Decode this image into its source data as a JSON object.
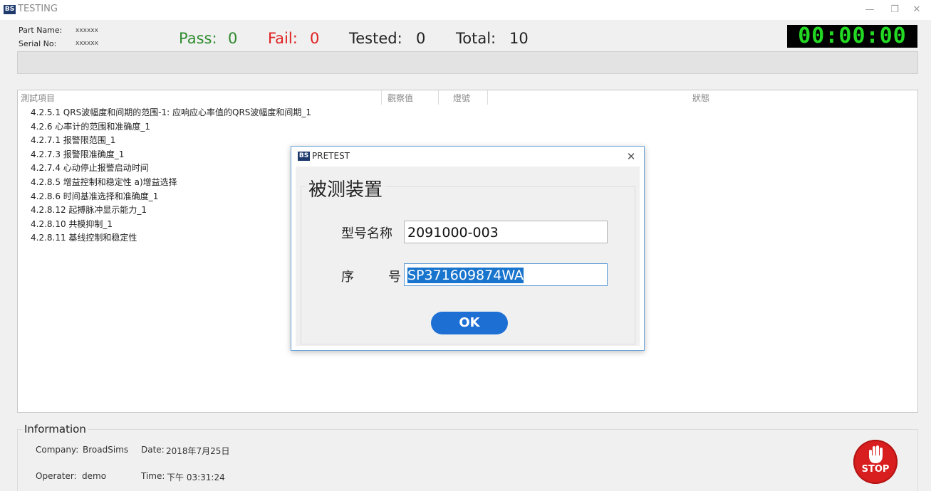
{
  "window": {
    "logo": "BS",
    "title": "TESTING",
    "controls": {
      "minimize": "—",
      "maximize": "❐",
      "close": "✕"
    }
  },
  "header": {
    "part_name_label": "Part Name:",
    "part_name_value": "xxxxxx",
    "serial_no_label": "Serial No:",
    "serial_no_value": "xxxxxx",
    "pass_label": "Pass:",
    "pass_value": "0",
    "fail_label": "Fail:",
    "fail_value": "0",
    "tested_label": "Tested:",
    "tested_value": "0",
    "total_label": "Total:",
    "total_value": "10",
    "timer": "00:00:00",
    "colors": {
      "pass": "#2e8b2e",
      "fail": "#e02020",
      "timer": "#23d923"
    }
  },
  "list": {
    "columns": [
      "測試項目",
      "觀察值",
      "燈號",
      "狀態"
    ],
    "items": [
      "4.2.5.1 QRS波幅度和间期的范围-1: 应响应心率值的QRS波幅度和间期_1",
      "4.2.6 心率计的范围和准确度_1",
      "4.2.7.1 报警限范围_1",
      "4.2.7.3 报警限准确度_1",
      "4.2.7.4 心动停止报警启动时间",
      "4.2.8.5 增益控制和稳定性 a)增益选择",
      "4.2.8.6 时间基准选择和准确度_1",
      "4.2.8.12 起搏脉冲显示能力_1",
      "4.2.8.10 共模抑制_1",
      "4.2.8.11 基线控制和稳定性"
    ]
  },
  "info": {
    "legend": "Information",
    "company_label": "Company:",
    "company_value": "BroadSims",
    "date_label": "Date:",
    "date_value": "2018年7月25日",
    "operator_label": "Operater:",
    "operator_value": "demo",
    "time_label": "Time:",
    "time_value": "下午 03:31:24",
    "stop_label": "STOP"
  },
  "dialog": {
    "logo": "BS",
    "title": "PRETEST",
    "close": "✕",
    "group_title": "被测装置",
    "model_label": "型号名称",
    "model_value": "2091000-003",
    "serial_label_a": "序",
    "serial_label_b": "号",
    "serial_value": "SP371609874WA",
    "ok_label": "OK"
  }
}
